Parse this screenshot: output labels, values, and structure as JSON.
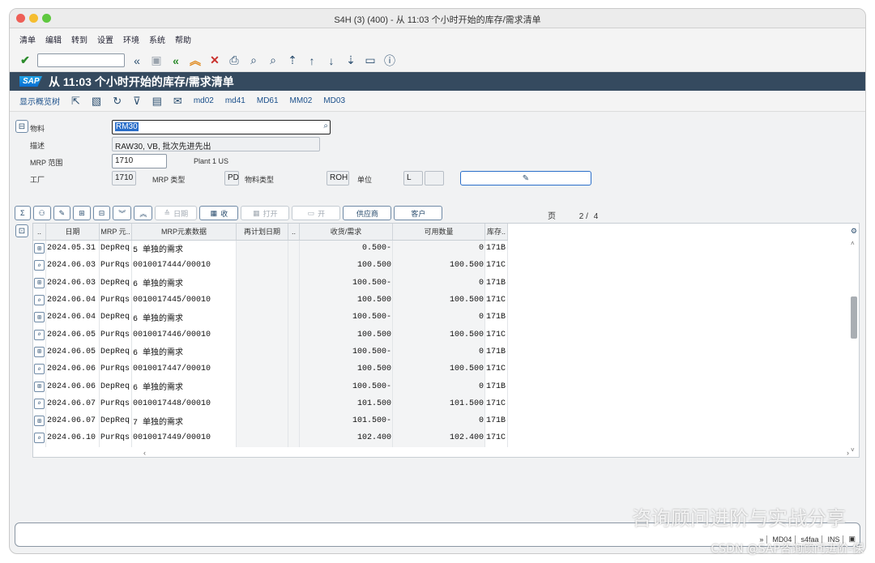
{
  "window": {
    "title": "S4H (3) (400) - 从 11:03 个小时开始的库存/需求清单"
  },
  "menu": [
    "清单",
    "编辑",
    "转到",
    "设置",
    "环境",
    "系统",
    "帮助"
  ],
  "header": {
    "logo": "SAP",
    "title": "从 11:03 个小时开始的库存/需求清单"
  },
  "app_toolbar": {
    "show_tree": "显示概览树",
    "links": [
      "md02",
      "md41",
      "MD61",
      "MM02",
      "MD03"
    ]
  },
  "form": {
    "material_label": "物料",
    "material_value": "RM30",
    "desc_label": "描述",
    "desc_value": "RAW30, VB, 批次先进先出",
    "mrp_area_label": "MRP 范围",
    "mrp_area_value": "1710",
    "mrp_area_text": "Plant 1 US",
    "plant_label": "工厂",
    "plant_value": "1710",
    "mrp_type_label": "MRP 类型",
    "mrp_type_value": "PD",
    "mat_type_label": "物料类型",
    "mat_type_value": "ROH",
    "unit_label": "单位",
    "unit_value": "L"
  },
  "grid_toolbar": {
    "date": "日期",
    "receipt": "收",
    "open": "打开",
    "open2": "开",
    "vendor": "供应商",
    "customer": "客户"
  },
  "page": {
    "label": "页",
    "current": "2",
    "total": "4"
  },
  "table": {
    "headers": [
      "..",
      "日期",
      "MRP 元..",
      "MRP元素数据",
      "再计划日期",
      "..",
      "收货/需求",
      "可用数量",
      "库存.."
    ],
    "rows": [
      {
        "icon": "req",
        "date": "2024.05.31",
        "elem": "DepReq",
        "data": "5 单独的需求",
        "qty": "0.500-",
        "avail": "0",
        "stock": "171B"
      },
      {
        "icon": "pr",
        "date": "2024.06.03",
        "elem": "PurRqs",
        "data": "0010017444/00010",
        "qty": "100.500",
        "avail": "100.500",
        "stock": "171C"
      },
      {
        "icon": "req",
        "date": "2024.06.03",
        "elem": "DepReq",
        "data": "6 单独的需求",
        "qty": "100.500-",
        "avail": "0",
        "stock": "171B"
      },
      {
        "icon": "pr",
        "date": "2024.06.04",
        "elem": "PurRqs",
        "data": "0010017445/00010",
        "qty": "100.500",
        "avail": "100.500",
        "stock": "171C"
      },
      {
        "icon": "req",
        "date": "2024.06.04",
        "elem": "DepReq",
        "data": "6 单独的需求",
        "qty": "100.500-",
        "avail": "0",
        "stock": "171B"
      },
      {
        "icon": "pr",
        "date": "2024.06.05",
        "elem": "PurRqs",
        "data": "0010017446/00010",
        "qty": "100.500",
        "avail": "100.500",
        "stock": "171C"
      },
      {
        "icon": "req",
        "date": "2024.06.05",
        "elem": "DepReq",
        "data": "6 单独的需求",
        "qty": "100.500-",
        "avail": "0",
        "stock": "171B"
      },
      {
        "icon": "pr",
        "date": "2024.06.06",
        "elem": "PurRqs",
        "data": "0010017447/00010",
        "qty": "100.500",
        "avail": "100.500",
        "stock": "171C"
      },
      {
        "icon": "req",
        "date": "2024.06.06",
        "elem": "DepReq",
        "data": "6 单独的需求",
        "qty": "100.500-",
        "avail": "0",
        "stock": "171B"
      },
      {
        "icon": "pr",
        "date": "2024.06.07",
        "elem": "PurRqs",
        "data": "0010017448/00010",
        "qty": "101.500",
        "avail": "101.500",
        "stock": "171C"
      },
      {
        "icon": "req",
        "date": "2024.06.07",
        "elem": "DepReq",
        "data": "7 单独的需求",
        "qty": "101.500-",
        "avail": "0",
        "stock": "171B"
      },
      {
        "icon": "pr",
        "date": "2024.06.10",
        "elem": "PurRqs",
        "data": "0010017449/00010",
        "qty": "102.400",
        "avail": "102.400",
        "stock": "171C"
      }
    ]
  },
  "status": {
    "tcode": "MD04",
    "server": "s4faa",
    "mode": "INS"
  },
  "watermark": {
    "line1": "咨询顾问进阶与实战分享",
    "line2": "CSDN @SAP咨询顾问进阶-保"
  }
}
